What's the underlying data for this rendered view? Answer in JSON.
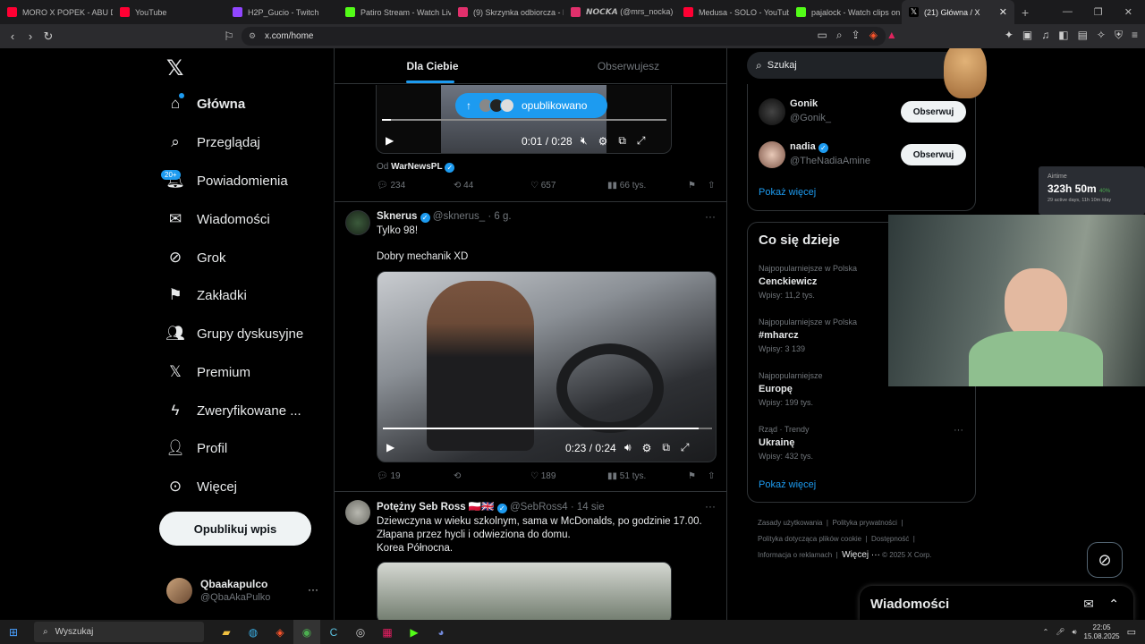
{
  "browser": {
    "tabs": [
      {
        "title": "MORO X POPEK - ABU DH",
        "color": "#ff0033"
      },
      {
        "title": "YouTube",
        "color": "#ff0033"
      },
      {
        "title": "H2P_Gucio - Twitch",
        "color": "#9146ff"
      },
      {
        "title": "Patiro Stream - Watch Live",
        "color": "#53fc18"
      },
      {
        "title": "(9) Skrzynka odbiorcza - D",
        "color": "#e1306c"
      },
      {
        "title": "𝙉𝙊𝘾𝙆𝘼 (@mrs_nocka) ·",
        "color": "#e1306c"
      },
      {
        "title": "Medusa - SOLO - YouTube",
        "color": "#ff0033"
      },
      {
        "title": "pajalock - Watch clips on",
        "color": "#53fc18"
      },
      {
        "title": "(21) Główna / X",
        "color": "#ffffff"
      }
    ],
    "url": "x.com/home"
  },
  "nav": {
    "items": [
      "Główna",
      "Przeglądaj",
      "Powiadomienia",
      "Wiadomości",
      "Grok",
      "Zakładki",
      "Grupy dyskusyjne",
      "Premium",
      "Zweryfikowane ...",
      "Profil",
      "Więcej"
    ],
    "badge": "20+",
    "post_button": "Opublikuj wpis",
    "profile_name": "Qbaakapulco",
    "profile_handle": "@QbaAkaPulko",
    "more_dots": "···"
  },
  "feed": {
    "tabs": [
      "Dla Ciebie",
      "Obserwujesz"
    ],
    "pill": "opublikowano",
    "tweet1": {
      "time": "0:01 / 0:28",
      "from_prefix": "Od",
      "from_name": "WarNewsPL",
      "replies": "234",
      "reposts": "44",
      "likes": "657",
      "views": "66 tys."
    },
    "tweet2": {
      "name": "Sknerus",
      "handle": "@sknerus_",
      "age": "· 6 g.",
      "line1": "Tylko 98!",
      "line2": "Dobry mechanik XD",
      "time": "0:23 / 0:24",
      "replies": "19",
      "reposts": "",
      "likes": "189",
      "views": "51 tys."
    },
    "tweet3": {
      "name": "Potężny Seb Ross 🇵🇱🇬🇧",
      "handle": "@SebRoss4",
      "age": "· 14 sie",
      "line1": "Dziewczyna w wieku szkolnym, sama w McDonalds, po godzinie 17.00.",
      "line2": "Złapana przez hycli i odwieziona do domu.",
      "line3": "Korea Północna."
    }
  },
  "sidebar": {
    "search_placeholder": "Szukaj",
    "who_to_follow": [
      {
        "name": "Gonik",
        "handle": "@Gonik_",
        "button": "Obserwuj"
      },
      {
        "name": "nadia",
        "handle": "@TheNadiaAmine",
        "button": "Obserwuj"
      }
    ],
    "show_more": "Pokaż więcej",
    "trends_title": "Co się dzieje",
    "trends": [
      {
        "context": "Najpopularniejsze w Polska",
        "name": "Cenckiewicz",
        "count": "Wpisy: 11,2 tys."
      },
      {
        "context": "Najpopularniejsze w Polska",
        "name": "#mharcz",
        "count": "Wpisy: 3 139"
      },
      {
        "context": "Najpopularniejsze",
        "name": "Europę",
        "count": "Wpisy: 199 tys."
      },
      {
        "context": "Rząd · Trendy",
        "name": "Ukrainę",
        "count": "Wpisy: 432 tys."
      }
    ],
    "trends_more": "Pokaż więcej",
    "footer": [
      "Zasady użytkowania",
      "Polityka prywatności",
      "Polityka dotycząca plików cookie",
      "Dostępność",
      "Informacja o reklamach",
      "Więcej ···",
      "© 2025 X Corp."
    ]
  },
  "messages_drawer": "Wiadomości",
  "airtime": {
    "label": "Airtime",
    "value": "323h 50m",
    "delta": "40%",
    "sub": "29 active days, 11h 10m /day"
  },
  "taskbar": {
    "search": "Wyszukaj",
    "time": "22:05",
    "date": "15.08.2025"
  },
  "colors": {
    "accent": "#1d9bf0",
    "bg": "#000000",
    "border": "#2f3336",
    "muted": "#71767b"
  }
}
